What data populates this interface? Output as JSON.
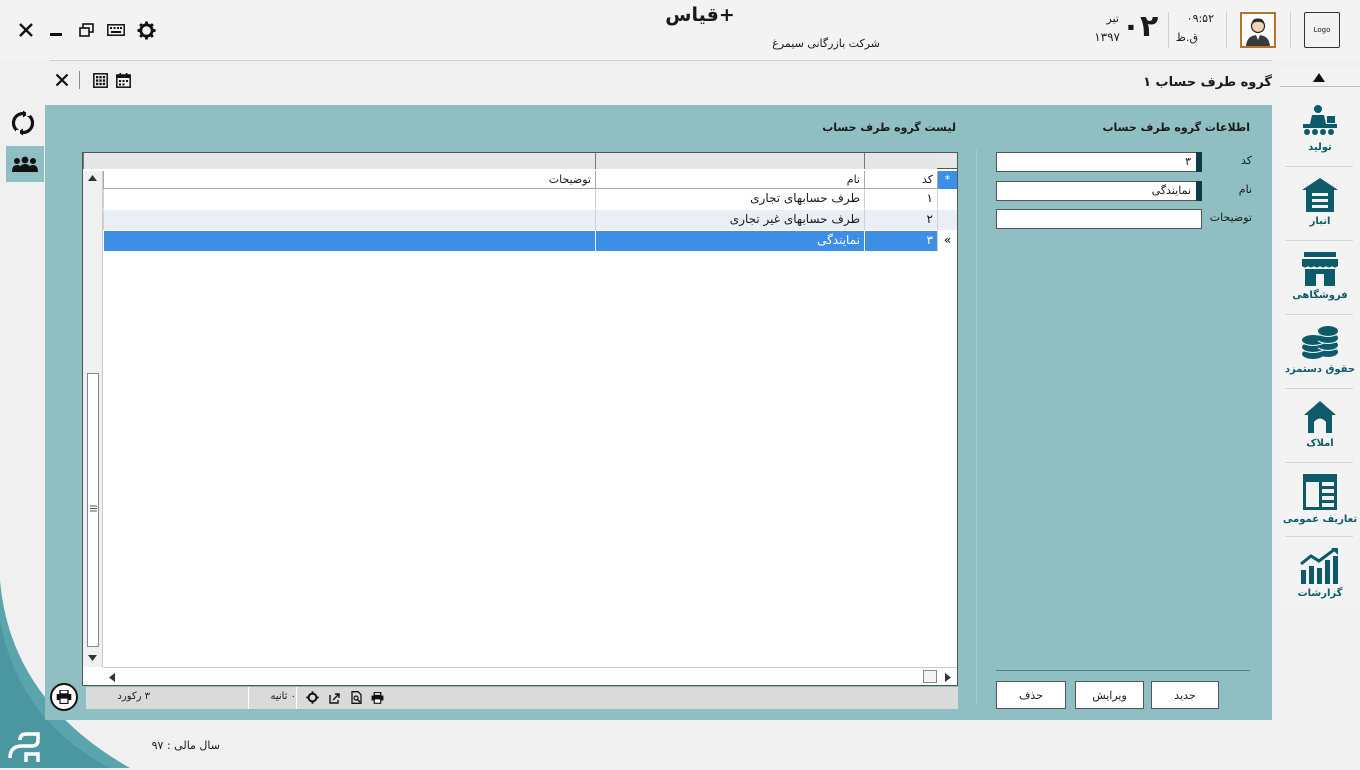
{
  "app": {
    "title": "قیاس+",
    "company": "شرکت بازرگانی سیمرغ",
    "logo_text": "Logo"
  },
  "clock": {
    "day": "۰۲",
    "month": "تیر",
    "year": "۱۳۹۷",
    "time": "۰۹:۵۲",
    "period": "ق.ظ"
  },
  "form": {
    "title": "گروه طرف حساب ۱",
    "info_section_title": "اطلاعات گروه طرف حساب",
    "list_section_title": "لیست گروه طرف حساب",
    "fields": {
      "code_label": "کد",
      "code_value": "۳",
      "name_label": "نام",
      "name_value": "نمایندگی",
      "desc_label": "توضیحات",
      "desc_value": ""
    },
    "buttons": {
      "new": "جدید",
      "edit": "ویرایش",
      "delete": "حذف"
    }
  },
  "grid": {
    "columns": [
      "کد",
      "نام",
      "توضیحات"
    ],
    "new_row_marker": "*",
    "current_row_marker": "»",
    "rows": [
      {
        "code": "۱",
        "name": "طرف حسابهای تجاری",
        "desc": ""
      },
      {
        "code": "۲",
        "name": "طرف حسابهای غیر تجاری",
        "desc": ""
      },
      {
        "code": "۳",
        "name": "نمایندگی",
        "desc": ""
      }
    ],
    "selected_index": 2
  },
  "statusbar": {
    "record_count": "۳ رکورد",
    "timer": "۰ ثانیه"
  },
  "sidebar": {
    "items": [
      {
        "label": "تولید",
        "icon": "production-icon"
      },
      {
        "label": "انبار",
        "icon": "warehouse-icon"
      },
      {
        "label": "فروشگاهی",
        "icon": "store-icon"
      },
      {
        "label": "حقوق دستمزد",
        "icon": "payroll-coins-icon"
      },
      {
        "label": "املاک",
        "icon": "real-estate-icon"
      },
      {
        "label": "تعاریف عمومی",
        "icon": "definitions-icon"
      },
      {
        "label": "گزارشات",
        "icon": "reports-chart-icon"
      }
    ]
  },
  "footer": {
    "fiscal_year": "سال مالی : ۹۷"
  },
  "colors": {
    "panel": "#8fbfc3",
    "accent": "#0d5a6b",
    "selection": "#3d8fe6"
  }
}
